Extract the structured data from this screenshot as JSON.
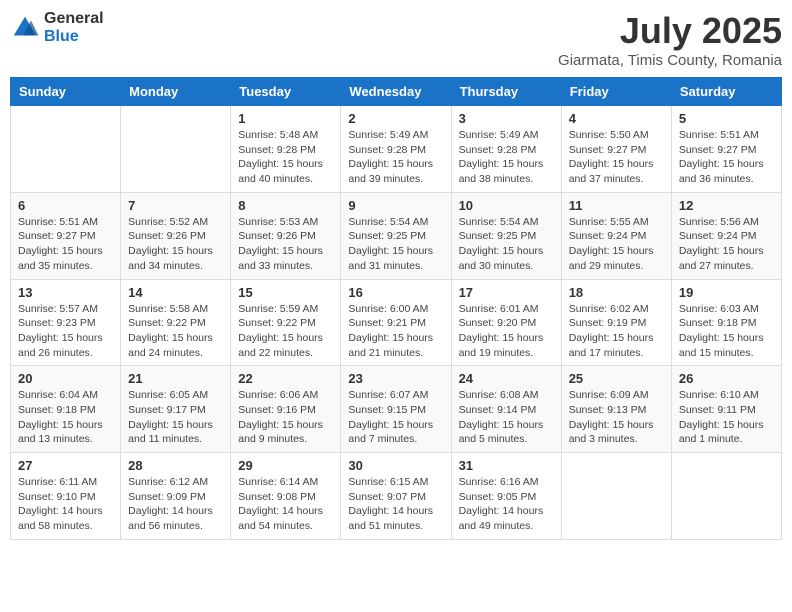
{
  "header": {
    "logo_general": "General",
    "logo_blue": "Blue",
    "title": "July 2025",
    "subtitle": "Giarmata, Timis County, Romania"
  },
  "weekdays": [
    "Sunday",
    "Monday",
    "Tuesday",
    "Wednesday",
    "Thursday",
    "Friday",
    "Saturday"
  ],
  "weeks": [
    [
      {
        "day": "",
        "info": ""
      },
      {
        "day": "",
        "info": ""
      },
      {
        "day": "1",
        "info": "Sunrise: 5:48 AM\nSunset: 9:28 PM\nDaylight: 15 hours\nand 40 minutes."
      },
      {
        "day": "2",
        "info": "Sunrise: 5:49 AM\nSunset: 9:28 PM\nDaylight: 15 hours\nand 39 minutes."
      },
      {
        "day": "3",
        "info": "Sunrise: 5:49 AM\nSunset: 9:28 PM\nDaylight: 15 hours\nand 38 minutes."
      },
      {
        "day": "4",
        "info": "Sunrise: 5:50 AM\nSunset: 9:27 PM\nDaylight: 15 hours\nand 37 minutes."
      },
      {
        "day": "5",
        "info": "Sunrise: 5:51 AM\nSunset: 9:27 PM\nDaylight: 15 hours\nand 36 minutes."
      }
    ],
    [
      {
        "day": "6",
        "info": "Sunrise: 5:51 AM\nSunset: 9:27 PM\nDaylight: 15 hours\nand 35 minutes."
      },
      {
        "day": "7",
        "info": "Sunrise: 5:52 AM\nSunset: 9:26 PM\nDaylight: 15 hours\nand 34 minutes."
      },
      {
        "day": "8",
        "info": "Sunrise: 5:53 AM\nSunset: 9:26 PM\nDaylight: 15 hours\nand 33 minutes."
      },
      {
        "day": "9",
        "info": "Sunrise: 5:54 AM\nSunset: 9:25 PM\nDaylight: 15 hours\nand 31 minutes."
      },
      {
        "day": "10",
        "info": "Sunrise: 5:54 AM\nSunset: 9:25 PM\nDaylight: 15 hours\nand 30 minutes."
      },
      {
        "day": "11",
        "info": "Sunrise: 5:55 AM\nSunset: 9:24 PM\nDaylight: 15 hours\nand 29 minutes."
      },
      {
        "day": "12",
        "info": "Sunrise: 5:56 AM\nSunset: 9:24 PM\nDaylight: 15 hours\nand 27 minutes."
      }
    ],
    [
      {
        "day": "13",
        "info": "Sunrise: 5:57 AM\nSunset: 9:23 PM\nDaylight: 15 hours\nand 26 minutes."
      },
      {
        "day": "14",
        "info": "Sunrise: 5:58 AM\nSunset: 9:22 PM\nDaylight: 15 hours\nand 24 minutes."
      },
      {
        "day": "15",
        "info": "Sunrise: 5:59 AM\nSunset: 9:22 PM\nDaylight: 15 hours\nand 22 minutes."
      },
      {
        "day": "16",
        "info": "Sunrise: 6:00 AM\nSunset: 9:21 PM\nDaylight: 15 hours\nand 21 minutes."
      },
      {
        "day": "17",
        "info": "Sunrise: 6:01 AM\nSunset: 9:20 PM\nDaylight: 15 hours\nand 19 minutes."
      },
      {
        "day": "18",
        "info": "Sunrise: 6:02 AM\nSunset: 9:19 PM\nDaylight: 15 hours\nand 17 minutes."
      },
      {
        "day": "19",
        "info": "Sunrise: 6:03 AM\nSunset: 9:18 PM\nDaylight: 15 hours\nand 15 minutes."
      }
    ],
    [
      {
        "day": "20",
        "info": "Sunrise: 6:04 AM\nSunset: 9:18 PM\nDaylight: 15 hours\nand 13 minutes."
      },
      {
        "day": "21",
        "info": "Sunrise: 6:05 AM\nSunset: 9:17 PM\nDaylight: 15 hours\nand 11 minutes."
      },
      {
        "day": "22",
        "info": "Sunrise: 6:06 AM\nSunset: 9:16 PM\nDaylight: 15 hours\nand 9 minutes."
      },
      {
        "day": "23",
        "info": "Sunrise: 6:07 AM\nSunset: 9:15 PM\nDaylight: 15 hours\nand 7 minutes."
      },
      {
        "day": "24",
        "info": "Sunrise: 6:08 AM\nSunset: 9:14 PM\nDaylight: 15 hours\nand 5 minutes."
      },
      {
        "day": "25",
        "info": "Sunrise: 6:09 AM\nSunset: 9:13 PM\nDaylight: 15 hours\nand 3 minutes."
      },
      {
        "day": "26",
        "info": "Sunrise: 6:10 AM\nSunset: 9:11 PM\nDaylight: 15 hours\nand 1 minute."
      }
    ],
    [
      {
        "day": "27",
        "info": "Sunrise: 6:11 AM\nSunset: 9:10 PM\nDaylight: 14 hours\nand 58 minutes."
      },
      {
        "day": "28",
        "info": "Sunrise: 6:12 AM\nSunset: 9:09 PM\nDaylight: 14 hours\nand 56 minutes."
      },
      {
        "day": "29",
        "info": "Sunrise: 6:14 AM\nSunset: 9:08 PM\nDaylight: 14 hours\nand 54 minutes."
      },
      {
        "day": "30",
        "info": "Sunrise: 6:15 AM\nSunset: 9:07 PM\nDaylight: 14 hours\nand 51 minutes."
      },
      {
        "day": "31",
        "info": "Sunrise: 6:16 AM\nSunset: 9:05 PM\nDaylight: 14 hours\nand 49 minutes."
      },
      {
        "day": "",
        "info": ""
      },
      {
        "day": "",
        "info": ""
      }
    ]
  ]
}
